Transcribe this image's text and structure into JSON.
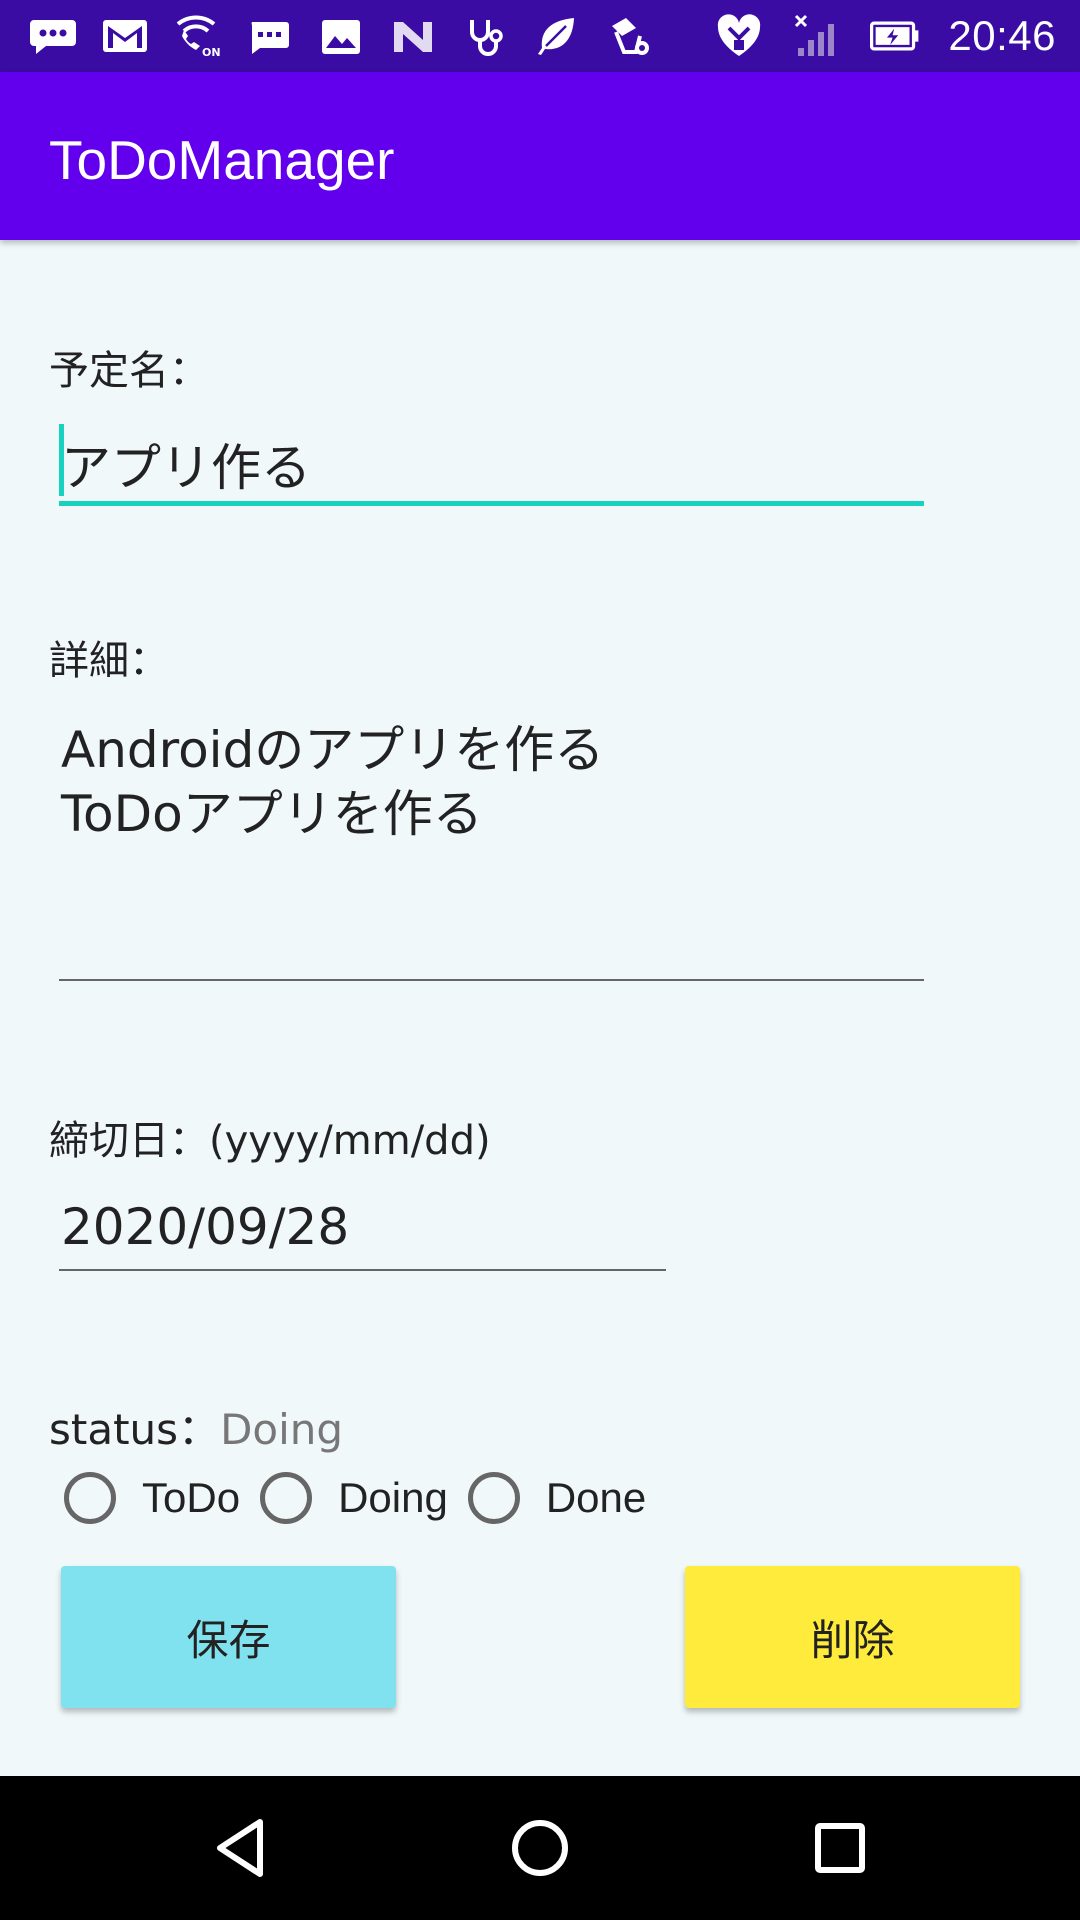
{
  "status_bar": {
    "time": "20:46",
    "left_icons": [
      "chat-notification-icon",
      "gmail-icon",
      "wifi-calling-on-icon",
      "message-icon",
      "gallery-icon",
      "app-n-icon",
      "stethoscope-icon",
      "leaf-icon",
      "bucket-settings-icon"
    ],
    "right_icons": [
      "heart-shield-icon",
      "signal-no-service-icon",
      "battery-charging-icon"
    ]
  },
  "app_bar": {
    "title": "ToDoManager"
  },
  "form": {
    "name_label": "予定名：",
    "name_value": "アプリ作る",
    "detail_label": "詳細：",
    "detail_lines": [
      "Androidのアプリを作る",
      "ToDoアプリを作る"
    ],
    "deadline_label": "締切日：(yyyy/mm/dd)",
    "deadline_value": "2020/09/28",
    "status_label": "status：",
    "status_value": "Doing",
    "radio_options": [
      "ToDo",
      "Doing",
      "Done"
    ]
  },
  "buttons": {
    "save": "保存",
    "delete": "削除"
  },
  "colors": {
    "status_bar": "#3A0CA3",
    "app_bar": "#6200EE",
    "background": "#F0F8FA",
    "focus_accent": "#18D2BF",
    "save_button": "#80E2EF",
    "delete_button": "#FFEB3B"
  },
  "nav_bar": {
    "buttons": [
      "back-icon",
      "home-icon",
      "recents-icon"
    ]
  }
}
